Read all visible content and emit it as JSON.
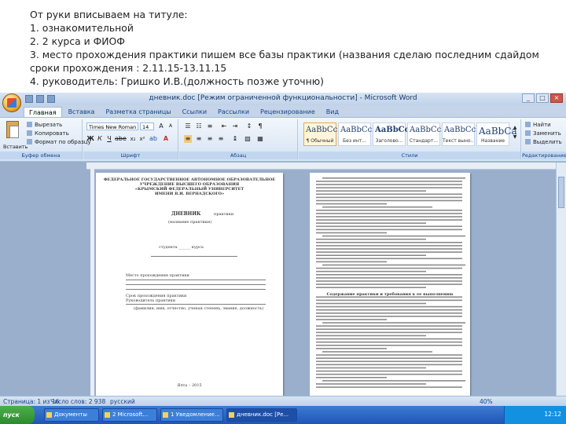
{
  "notes": {
    "lines": [
      "От руки вписываем на титуле:",
      "1. ознакомительной",
      "2. 2 курса и ФИОФ",
      "3. место прохождения практики пишем все базы практики (названия сделаю последним сдайдом",
      "сроки прохождения : 2.11.15-13.11.15",
      "4. руководитель: Гришко И.В.(должность позже уточню)"
    ]
  },
  "window": {
    "title": "дневник.doc [Режим ограниченной функциональности] - Microsoft Word"
  },
  "ribbon": {
    "tabs": [
      "Главная",
      "Вставка",
      "Разметка страницы",
      "Ссылки",
      "Рассылки",
      "Рецензирование",
      "Вид"
    ],
    "clipboard": {
      "paste": "Вставить",
      "cut": "Вырезать",
      "copy": "Копировать",
      "format_painter": "Формат по образцу",
      "label": "Буфер обмена"
    },
    "font": {
      "name": "Times New Roman",
      "size": "14",
      "label": "Шрифт"
    },
    "paragraph": {
      "label": "Абзац"
    },
    "styles": {
      "items": [
        {
          "sample": "AaBbCcDc",
          "name": "¶ Обычный"
        },
        {
          "sample": "AaBbCcDc",
          "name": "Без инт..."
        },
        {
          "sample": "AaBbCcD",
          "name": "Заголово..."
        },
        {
          "sample": "AaBbCcDc",
          "name": "Стандарт..."
        },
        {
          "sample": "AaBbCcDc",
          "name": "Текст выно..."
        },
        {
          "sample": "AaBbCa",
          "name": "Название"
        }
      ],
      "label": "Стили"
    },
    "editing": {
      "find": "Найти",
      "replace": "Заменить",
      "select": "Выделить",
      "label": "Редактирование"
    }
  },
  "document": {
    "page1": {
      "org_lines": [
        "ФЕДЕРАЛЬНОЕ ГОСУДАРСТВЕННОЕ АВТОНОМНОЕ ОБРАЗОВАТЕЛЬНОЕ",
        "УЧРЕЖДЕНИЕ ВЫСШЕГО ОБРАЗОВАНИЯ",
        "«КРЫМСКИЙ ФЕДЕРАЛЬНЫЙ УНИВЕРСИТЕТ",
        "ИМЕНИ В.И. ВЕРНАДСКОГО»"
      ],
      "heading": "ДНЕВНИК",
      "heading_note": "практики",
      "type_note": "(название практики)",
      "student_line": "студента ______ курса",
      "place_label": "Место прохождения практики",
      "period_label": "Срок прохождения практики",
      "supervisor_label": "Руководитель практики",
      "supervisor_note": "(фамилия, имя, отчество, ученая степень, звание, должность)",
      "city_year": "Ялта – 2015"
    },
    "page2": {
      "section_title": "Содержание практики и требования к ее выполнению"
    }
  },
  "statusbar": {
    "page": "Страница: 1 из 16",
    "words": "Число слов: 2 938",
    "lang": "русский",
    "zoom": "40%"
  },
  "taskbar": {
    "start": "пуск",
    "tasks": [
      "Документы",
      "2 Microsoft...",
      "1 Уведомление...",
      "дневник.doc [Ре..."
    ],
    "clock": "12:12"
  },
  "colors": {
    "ribbon_top": "#f3f7fc",
    "ribbon_bottom": "#d5e3f3",
    "doc_background": "#9aafcb",
    "taskbar": "#2a62c2",
    "start_button": "#3a9a3a"
  },
  "icons": {
    "office_button": "office-logo-icon",
    "paste": "clipboard-icon",
    "find": "binoculars-icon"
  }
}
